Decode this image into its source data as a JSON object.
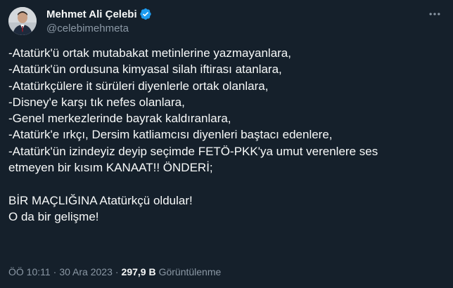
{
  "author": {
    "display_name": "Mehmet Ali Çelebi",
    "handle": "@celebimehmeta",
    "verified": true,
    "avatar": "profile-photo",
    "verified_icon": "verified-badge-icon",
    "more_icon": "more-options-icon"
  },
  "tweet": {
    "lines": [
      "-Atatürk'ü ortak mutabakat metinlerine yazmayanlara,",
      "-Atatürk'ün ordusuna kimyasal silah iftirası atanlara,",
      "-Atatürkçülere it sürüleri diyenlerle ortak olanlara,",
      "-Disney'e karşı tık nefes olanlara,",
      "-Genel merkezlerinde bayrak kaldıranlara,",
      "-Atatürk'e ırkçı, Dersim katliamcısı diyenleri baştacı edenlere,",
      "-Atatürk'ün izindeyiz deyip seçimde FETÖ-PKK'ya umut verenlere ses",
      "etmeyen bir kısım KANAAT!! ÖNDERİ;",
      "",
      "BİR MAÇLIĞINA Atatürkçü oldular!",
      "O da bir gelişme!"
    ]
  },
  "meta": {
    "time": "ÖÖ 10:11",
    "separator": "·",
    "date": "30 Ara 2023",
    "views_count": "297,9 B",
    "views_label": "Görüntülenme"
  },
  "colors": {
    "background": "#15202b",
    "text_primary": "#f7f9f9",
    "text_secondary": "#8b98a5",
    "verified_blue": "#1d9bf0"
  }
}
